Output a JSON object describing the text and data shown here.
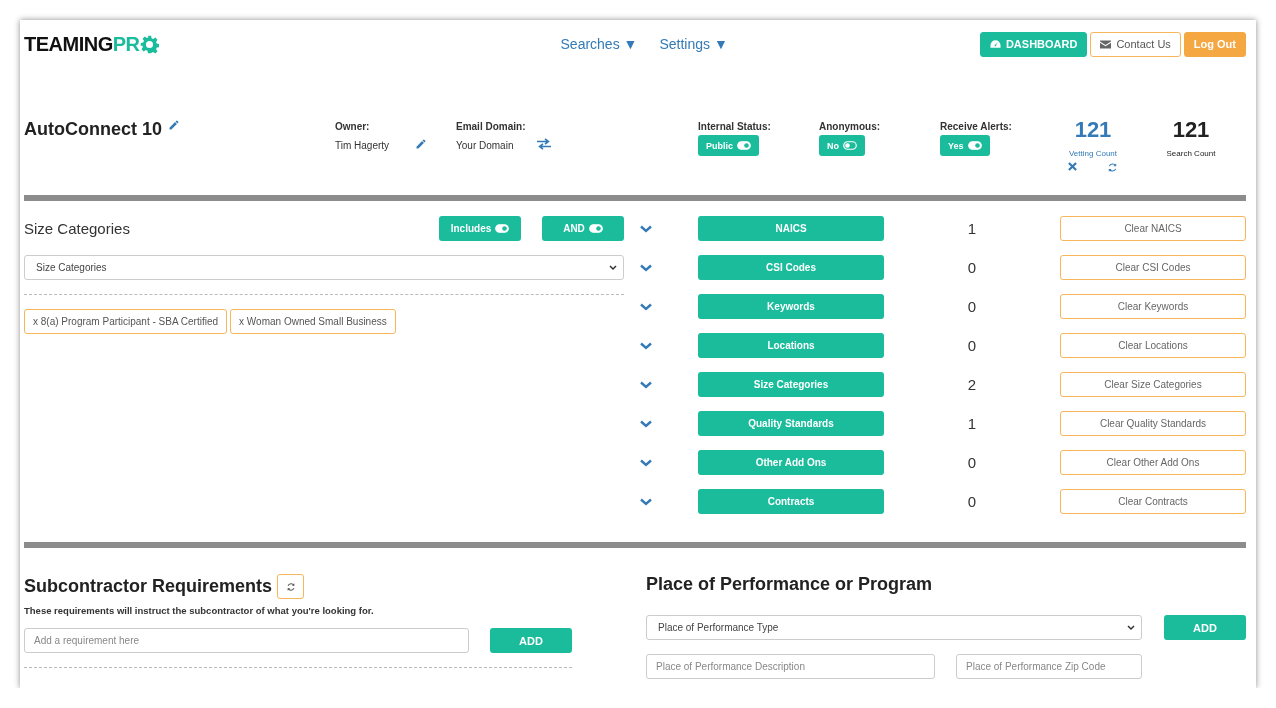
{
  "header": {
    "logo": {
      "dark": "TEAMING",
      "accent": "PR"
    },
    "nav": [
      {
        "label": "Searches",
        "caret": "▼"
      },
      {
        "label": "Settings",
        "caret": "▼"
      }
    ],
    "buttons": [
      {
        "kind": "dashboard",
        "label": "DASHBOARD"
      },
      {
        "kind": "contact",
        "label": "Contact Us"
      },
      {
        "kind": "logout",
        "label": "Log Out"
      }
    ]
  },
  "search": {
    "title": "AutoConnect 10",
    "owner": {
      "label": "Owner:",
      "value": "Tim Hagerty"
    },
    "email_domain": {
      "label": "Email Domain:",
      "value": "Your Domain"
    },
    "toggles": [
      {
        "label": "Internal Status:",
        "value": "Public",
        "on": true
      },
      {
        "label": "Anonymous:",
        "value": "No",
        "on": false
      },
      {
        "label": "Receive Alerts:",
        "value": "Yes",
        "on": true
      }
    ],
    "vetting": {
      "count": "121",
      "label": "Vetting Count"
    },
    "search_count": {
      "count": "121",
      "label": "Search Count"
    }
  },
  "size_panel": {
    "title": "Size Categories",
    "toggles": [
      {
        "label": "Includes",
        "on": true
      },
      {
        "label": "AND",
        "on": true
      }
    ],
    "select": "Size Categories",
    "tags": [
      "x 8(a) Program Participant - SBA Certified",
      "x Woman Owned Small Business"
    ]
  },
  "filters": [
    {
      "label": "NAICS",
      "count": "1",
      "clear": "Clear NAICS"
    },
    {
      "label": "CSI Codes",
      "count": "0",
      "clear": "Clear CSI Codes"
    },
    {
      "label": "Keywords",
      "count": "0",
      "clear": "Clear Keywords"
    },
    {
      "label": "Locations",
      "count": "0",
      "clear": "Clear Locations"
    },
    {
      "label": "Size Categories",
      "count": "2",
      "clear": "Clear Size Categories"
    },
    {
      "label": "Quality Standards",
      "count": "1",
      "clear": "Clear Quality Standards"
    },
    {
      "label": "Other Add Ons",
      "count": "0",
      "clear": "Clear Other Add Ons"
    },
    {
      "label": "Contracts",
      "count": "0",
      "clear": "Clear Contracts"
    }
  ],
  "requirements": {
    "title": "Subcontractor Requirements",
    "description": "These requirements will instruct the subcontractor of what you're looking for.",
    "placeholder": "Add a requirement here",
    "button": "ADD"
  },
  "place": {
    "title": "Place of Performance or Program",
    "select": "Place of Performance Type",
    "button": "ADD",
    "description_placeholder": "Place of Performance Description",
    "zip_placeholder": "Place of Performance Zip Code"
  }
}
